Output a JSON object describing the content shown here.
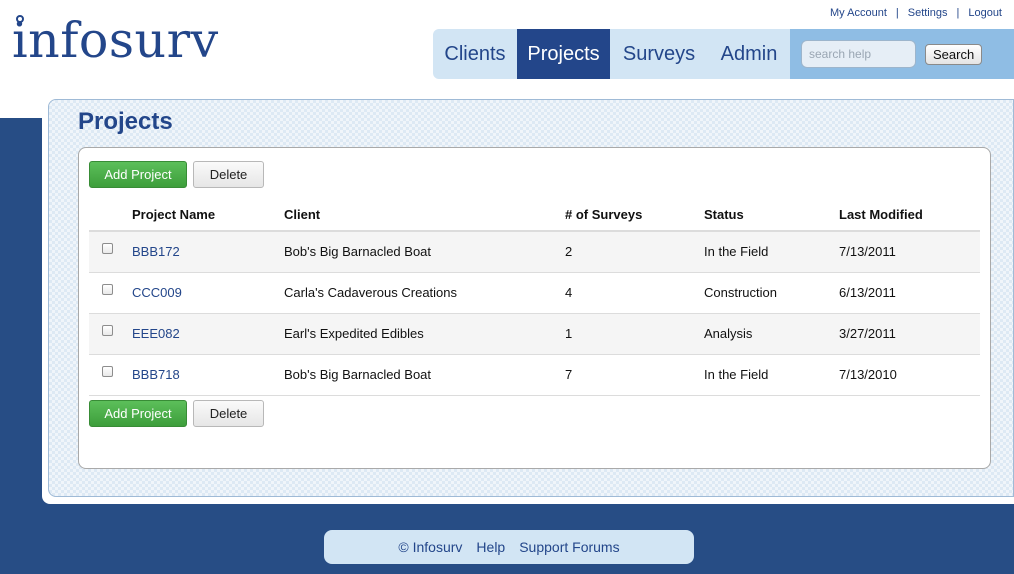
{
  "brand": {
    "name": "infosurv"
  },
  "top_links": [
    "My Account",
    "Settings",
    "Logout"
  ],
  "nav": {
    "tabs": [
      "Clients",
      "Projects",
      "Surveys",
      "Admin"
    ],
    "active": "Projects",
    "search_placeholder": "search help",
    "search_button": "Search"
  },
  "page": {
    "title": "Projects"
  },
  "actions": {
    "add_label": "Add Project",
    "delete_label": "Delete"
  },
  "table": {
    "headers": [
      "Project Name",
      "Client",
      "# of Surveys",
      "Status",
      "Last Modified"
    ],
    "rows": [
      {
        "name": "BBB172",
        "client": "Bob's Big Barnacled Boat",
        "surveys": "2",
        "status": "In the Field",
        "modified": "7/13/2011"
      },
      {
        "name": "CCC009",
        "client": "Carla's Cadaverous Creations",
        "surveys": "4",
        "status": "Construction",
        "modified": "6/13/2011"
      },
      {
        "name": "EEE082",
        "client": "Earl's Expedited Edibles",
        "surveys": "1",
        "status": "Analysis",
        "modified": "3/27/2011"
      },
      {
        "name": "BBB718",
        "client": "Bob's Big Barnacled Boat",
        "surveys": "7",
        "status": "In the Field",
        "modified": "7/13/2010"
      }
    ]
  },
  "footer": {
    "copyright": "© Infosurv",
    "help": "Help",
    "forums": "Support Forums"
  },
  "colors": {
    "brand_blue": "#23468a",
    "light_blue": "#d2e5f4",
    "search_blue": "#8fbde4",
    "green": "#4cae4a"
  }
}
